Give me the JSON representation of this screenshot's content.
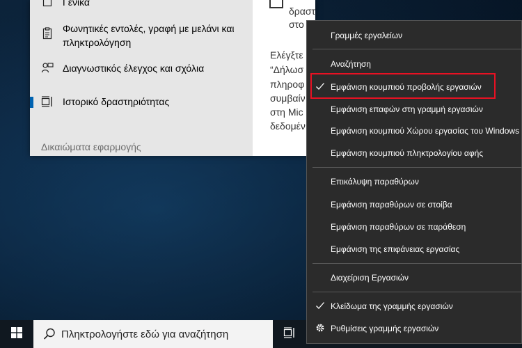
{
  "settings": {
    "nav_items": [
      {
        "label": "Γενικά",
        "icon": "lock-icon"
      },
      {
        "label": "Φωνητικές εντολές, γραφή με μελάνι και πληκτρολόγηση",
        "icon": "clipboard-icon"
      },
      {
        "label": "Διαγνωστικός έλεγχος και σχόλια",
        "icon": "feedback-icon"
      },
      {
        "label": "Ιστορικό δραστηριότητας",
        "icon": "timeline-icon"
      }
    ],
    "section_header": "Δικαιώματα εφαρμογής",
    "content": {
      "line1": "δραστηριότητές μου από αυτόν τον υπολογιστή",
      "line2": "στο",
      "p1": "Ελέγξτε",
      "p2": "“Δήλωσ",
      "p3": "πληροφ",
      "p4": "συμβαίν",
      "p5": "στη Mic",
      "p6": "δεδομέν"
    }
  },
  "taskbar": {
    "search_placeholder": "Πληκτρολογήστε εδώ για αναζήτηση"
  },
  "context_menu": {
    "items": [
      {
        "label": "Γραμμές εργαλείων",
        "checked": false
      },
      {
        "label": "Αναζήτηση",
        "checked": false
      },
      {
        "label": "Εμφάνιση κουμπιού προβολής εργασιών",
        "checked": true
      },
      {
        "label": "Εμφάνιση επαφών στη γραμμή εργασιών",
        "checked": false
      },
      {
        "label": "Εμφάνιση κουμπιού Χώρου εργασίας του Windows",
        "checked": false
      },
      {
        "label": "Εμφάνιση κουμπιού πληκτρολογίου αφής",
        "checked": false
      },
      {
        "label": "Επικάλυψη παραθύρων",
        "checked": false
      },
      {
        "label": "Εμφάνιση παραθύρων σε στοίβα",
        "checked": false
      },
      {
        "label": "Εμφάνιση παραθύρων σε παράθεση",
        "checked": false
      },
      {
        "label": "Εμφάνιση της επιφάνειας εργασίας",
        "checked": false
      },
      {
        "label": "Διαχείριση Εργασιών",
        "checked": false
      },
      {
        "label": "Κλείδωμα της γραμμής εργασιών",
        "checked": true
      },
      {
        "label": "Ρυθμίσεις γραμμής εργασιών",
        "icon": "gear-icon"
      }
    ]
  },
  "colors": {
    "accent": "#0063b1",
    "highlight_border": "#e81123",
    "menu_bg": "#2b2b2b",
    "taskbar_bg": "#101820"
  }
}
